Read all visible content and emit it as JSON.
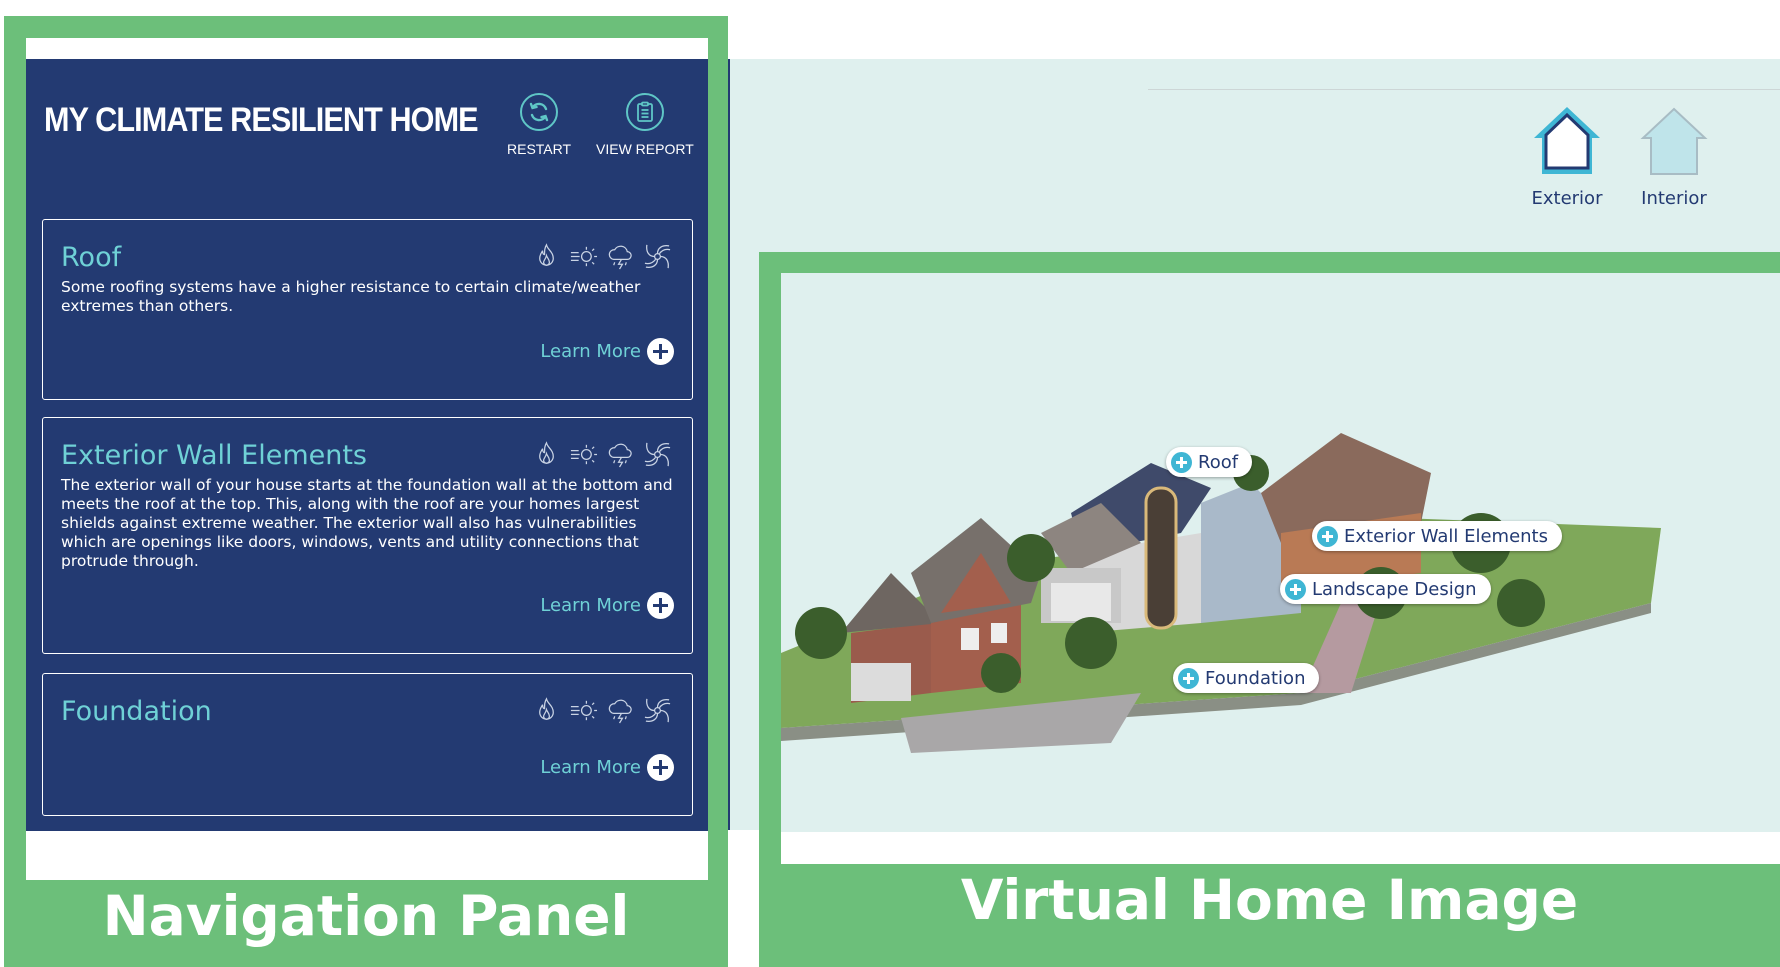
{
  "app": {
    "title": "MY CLIMATE RESILIENT HOME"
  },
  "header": {
    "restart_label": "RESTART",
    "report_label": "VIEW REPORT"
  },
  "cards": [
    {
      "title": "Roof",
      "description": "Some roofing systems have a higher resistance to certain climate/weather extremes than others.",
      "learn_more": "Learn More",
      "hazard_icons": [
        "wildfire-icon",
        "heat-icon",
        "storm-icon",
        "hurricane-icon"
      ]
    },
    {
      "title": "Exterior Wall Elements",
      "description": "The exterior wall of your house starts at the foundation wall at the bottom and meets the roof at the top. This, along with the roof are your homes largest shields against extreme weather. The exterior wall also has vulnerabilities which are openings like doors, windows, vents and utility connections that protrude through.",
      "learn_more": "Learn More",
      "hazard_icons": [
        "wildfire-icon",
        "heat-icon",
        "storm-icon",
        "hurricane-icon"
      ]
    },
    {
      "title": "Foundation",
      "description": "",
      "learn_more": "Learn More",
      "hazard_icons": [
        "wildfire-icon",
        "heat-icon",
        "storm-icon",
        "hurricane-icon"
      ]
    }
  ],
  "view_toggle": {
    "exterior_label": "Exterior",
    "interior_label": "Interior",
    "selected": "Exterior"
  },
  "hotspots": {
    "roof": "Roof",
    "exterior_wall": "Exterior Wall Elements",
    "landscape": "Landscape Design",
    "foundation": "Foundation"
  },
  "captions": {
    "navigation_panel": "Navigation Panel",
    "virtual_home_image": "Virtual Home Image"
  },
  "colors": {
    "panel_bg": "#233a72",
    "accent_teal": "#6fd1d6",
    "frame_green": "#6cbf7a",
    "scene_bg": "#dff0ee",
    "hotspot_blue": "#3fb6d4"
  }
}
